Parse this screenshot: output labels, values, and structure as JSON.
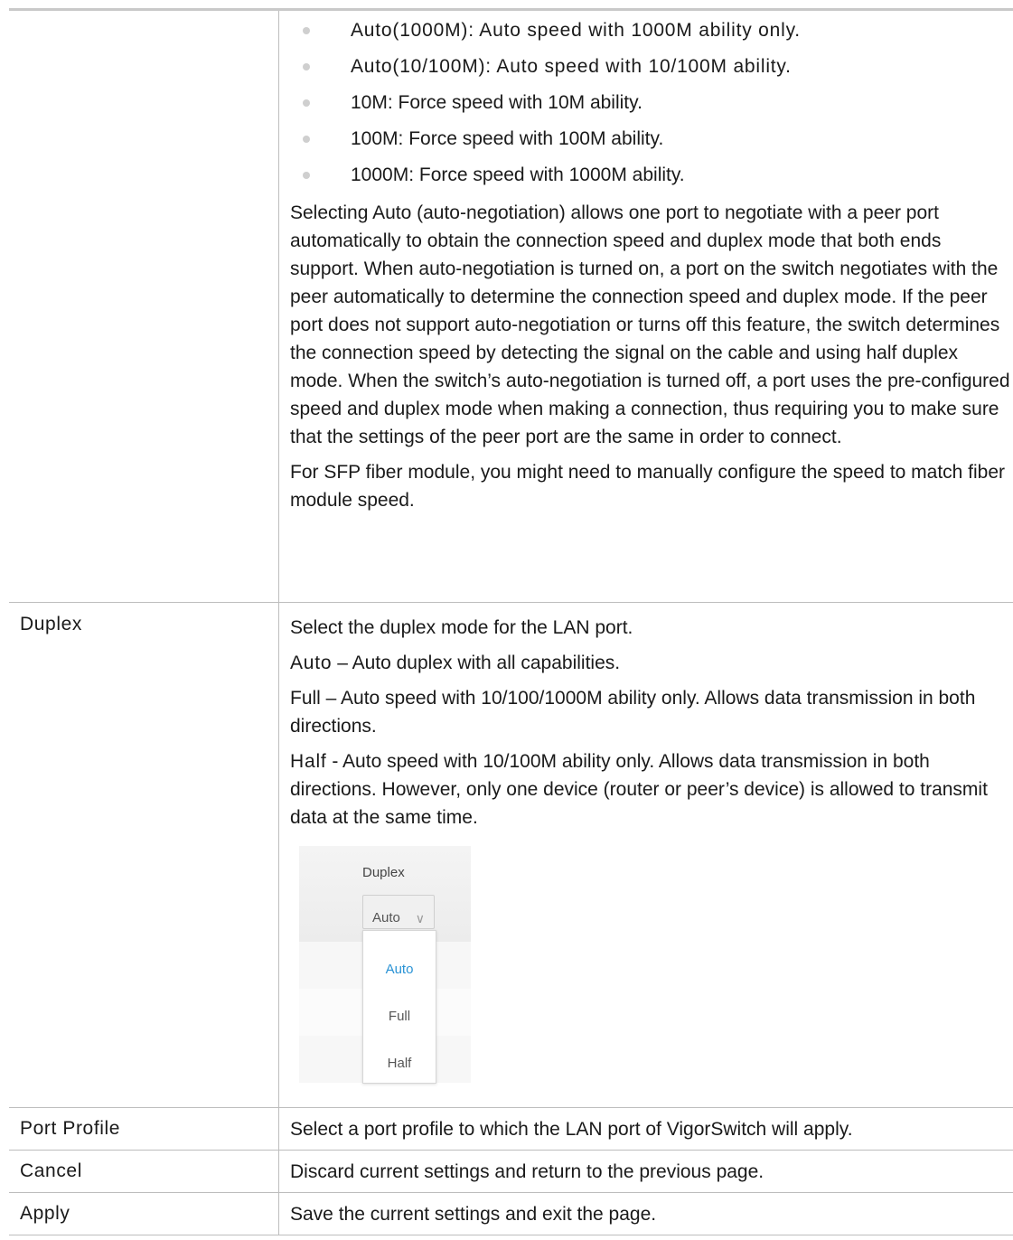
{
  "speed_options": [
    "Auto(1000M): Auto speed with 1000M ability only.",
    "Auto(10/100M): Auto speed with 10/100M ability.",
    "10M: Force speed with 10M ability.",
    "100M: Force speed with 100M ability.",
    "1000M: Force speed with 1000M ability."
  ],
  "speed_para1": "Selecting Auto (auto-negotiation) allows one port to negotiate with a peer port automatically to obtain the connection speed and duplex mode that both ends support. When auto-negotiation is turned on, a port on the switch negotiates with the peer automatically to determine the connection speed and duplex mode. If the peer port does not support auto-negotiation or turns off this feature, the switch determines the connection speed by detecting the signal on the cable and using half duplex mode. When the switch’s auto-negotiation is turned off, a port uses the pre-configured speed and duplex mode when making a connection, thus requiring you to make sure that the settings of the peer port are the same in order to connect.",
  "speed_para2": "For SFP fiber module, you might need to manually configure the speed to match fiber module speed.",
  "duplex": {
    "term": "Duplex",
    "intro": "Select the duplex mode for the LAN port.",
    "auto_key": "Auto",
    "auto_text": " – Auto duplex with all capabilities.",
    "full_text": "Full – Auto speed with 10/100/1000M ability only. Allows data transmission in both directions.",
    "half_key": "Half",
    "half_text": " - Auto speed with 10/100M ability only. Allows data transmission in both directions. However, only one device (router or peer’s device) is allowed to transmit data at the same time.",
    "shot": {
      "header": "Duplex",
      "selected": "Auto",
      "options": [
        "Auto",
        "Full",
        "Half"
      ]
    }
  },
  "port_profile": {
    "term": "Port Profile",
    "desc": "Select a port profile to which the LAN port of VigorSwitch will apply."
  },
  "cancel": {
    "term": "Cancel",
    "desc": "Discard current settings and return to the previous page."
  },
  "apply": {
    "term": "Apply",
    "desc": "Save the current settings and exit the page."
  }
}
